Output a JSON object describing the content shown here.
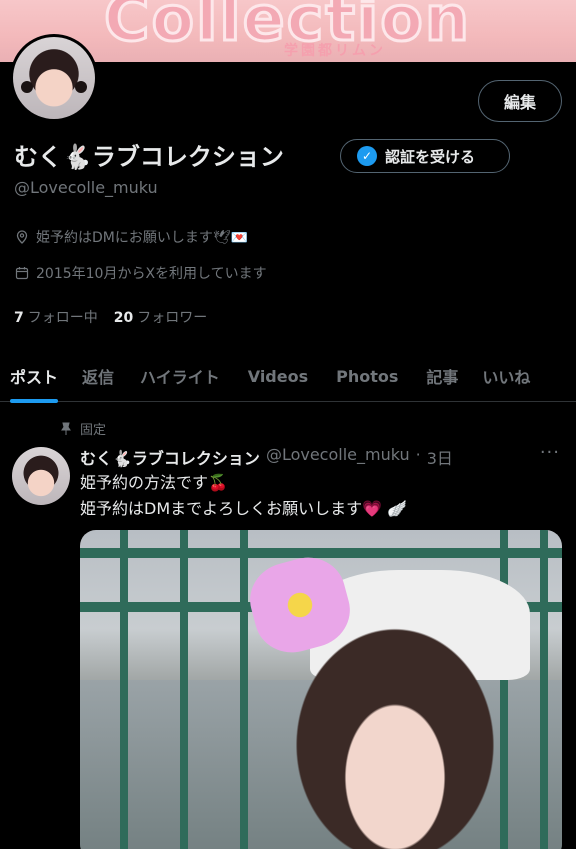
{
  "banner": {
    "text": "Collection",
    "subtext": "学園都リムン"
  },
  "profile": {
    "edit_label": "編集",
    "display_name": "むく🐇ラブコレクション",
    "verify_label": "認証を受ける",
    "handle": "@Lovecolle_muku",
    "location": "姫予約はDMにお願いします🕊💌",
    "joined": "2015年10月からXを利用しています",
    "following_count": "7",
    "following_label": "フォロー中",
    "followers_count": "20",
    "followers_label": "フォロワー"
  },
  "tabs": [
    {
      "label": "ポスト"
    },
    {
      "label": "返信"
    },
    {
      "label": "ハイライト"
    },
    {
      "label": "Videos"
    },
    {
      "label": "Photos"
    },
    {
      "label": "記事"
    },
    {
      "label": "いいね"
    }
  ],
  "post": {
    "pinned_label": "固定",
    "author": "むく🐇ラブコレクション",
    "handle": "@Lovecolle_muku",
    "time": "3日",
    "line1": "姫予約の方法です🍒",
    "line2": "姫予約はDMまでよろしくお願いします💗 🪽",
    "more": "···"
  },
  "colors": {
    "accent": "#1d9bf0",
    "muted": "#71767b",
    "text": "#e7e9ea"
  }
}
